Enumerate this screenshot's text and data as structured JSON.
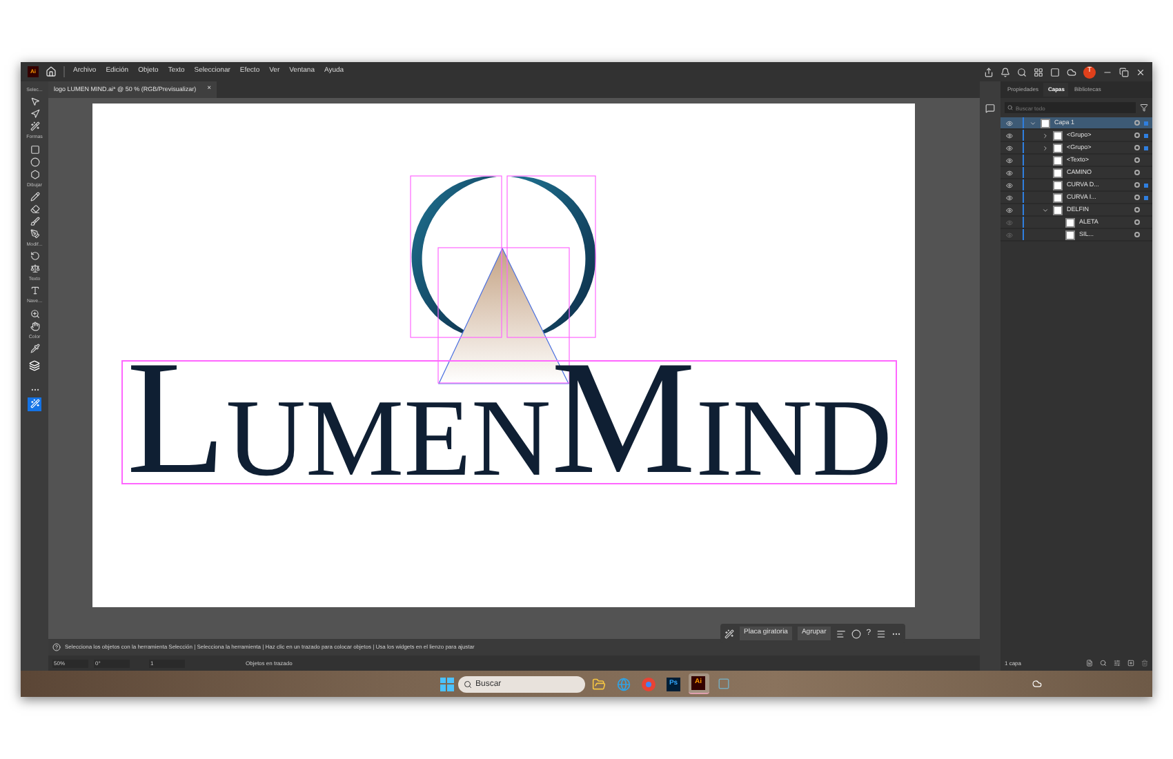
{
  "app_logo": "Ai",
  "menu": [
    "Archivo",
    "Edición",
    "Objeto",
    "Texto",
    "Seleccionar",
    "Efecto",
    "Ver",
    "Ventana",
    "Ayuda"
  ],
  "avatar": "T",
  "document_tab": {
    "title": "logo LUMEN MIND.ai* @ 50 % (RGB/Previsualizar)",
    "close": "×"
  },
  "toolbar": {
    "group_labels": [
      "Selec...",
      "Formas",
      "Dibujar",
      "Modif...",
      "Texto",
      "Nave...",
      "Color"
    ]
  },
  "artwork": {
    "words": [
      {
        "initial": "L",
        "rest": "UMEN"
      },
      {
        "initial": "M",
        "rest": "IND"
      }
    ]
  },
  "context_bar": {
    "buttons": [
      "Placa giratoria",
      "Agrupar"
    ],
    "help": "?"
  },
  "panel": {
    "tabs": [
      {
        "label": "Propiedades",
        "selected": false
      },
      {
        "label": "Capas",
        "selected": true
      },
      {
        "label": "Bibliotecas",
        "selected": false
      }
    ],
    "search": {
      "placeholder": "Buscar todo"
    },
    "layers": [
      {
        "name": "Capa 1",
        "selected": true,
        "expanded": true,
        "visible": true,
        "targeted": true,
        "children": [
          {
            "name": "<Grupo>",
            "selected": false,
            "expanded": false,
            "visible": true,
            "targeted": true
          },
          {
            "name": "<Grupo>",
            "selected": false,
            "expanded": false,
            "visible": true,
            "targeted": true
          },
          {
            "name": "<Texto>",
            "selected": false,
            "visible": true,
            "targeted": false
          },
          {
            "name": "CAMINO",
            "selected": false,
            "visible": true,
            "targeted": false
          },
          {
            "name": "CURVA D...",
            "selected": false,
            "visible": true,
            "targeted": true
          },
          {
            "name": "CURVA I...",
            "selected": false,
            "visible": true,
            "targeted": true
          },
          {
            "name": "DELFIN",
            "selected": false,
            "expanded": true,
            "visible": true,
            "targeted": false,
            "children": [
              {
                "name": "ALETA",
                "selected": false,
                "visible": false,
                "targeted": false
              },
              {
                "name": "SIL...",
                "selected": false,
                "visible": false,
                "targeted": false
              }
            ]
          }
        ]
      }
    ],
    "footer": "1 capa"
  },
  "status_bar": {
    "hint": "Selecciona los objetos con la herramienta Selección | Selecciona la herramienta | Haz clic en un trazado para colocar objetos | Usa los widgets en el lienzo para ajustar",
    "zoom": "50%",
    "rotation": "0°",
    "artboard": "1",
    "mode": "Objetos en trazado"
  },
  "taskbar": {
    "search": {
      "placeholder": "Buscar"
    },
    "apps": [
      {
        "kind": "folder",
        "selected": false
      },
      {
        "kind": "edge",
        "selected": false
      },
      {
        "kind": "chrome",
        "selected": false
      },
      {
        "kind": "ps",
        "label": "Ps",
        "selected": false
      },
      {
        "kind": "ai",
        "label": "Ai",
        "selected": true
      },
      {
        "kind": "other",
        "selected": false
      }
    ]
  }
}
